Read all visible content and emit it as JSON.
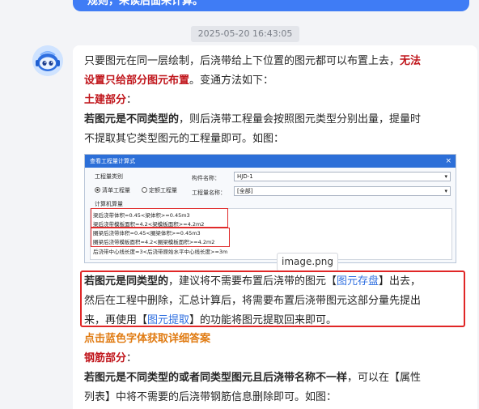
{
  "user_message": {
    "text": "规则，来读后面来计算。"
  },
  "timestamp": "2025-05-20 16:43:05",
  "intro": {
    "line1_normal": "只要图元在同一层绘制，后浇带给上下位置的图元都可以布置上去，",
    "line1_red": "无法",
    "line2_red": "设置只给部分图元布置",
    "line2_normal": "。变通方法如下："
  },
  "civil": {
    "heading": "土建部分",
    "colon": "：",
    "lead_bold": "若图元是不同类型的",
    "lead_rest": "，则后浇带工程量会按照图元类型分别出量，提量时",
    "line2": "不提取其它类型图元的工程量即可。如图："
  },
  "dialog": {
    "title": "查看工程量计算式",
    "close": "×",
    "category_label": "工程量类别",
    "radio_list": "清单工程量",
    "radio_quota": "定额工程量",
    "component_name_label": "构件名称：",
    "component_name_value": "HJD-1",
    "quantity_name_label": "工程量名称：",
    "quantity_name_value": "[全部]",
    "calc_label": "计算机算量",
    "results": [
      "梁后浇带体积=0.45<梁体积>=0.45m3",
      "梁后浇带模板面积=4.2<梁模板面积>=4.2m2",
      "圈梁后浇带体积=0.45<圈梁体积>=0.45m3",
      "圈梁后浇带模板面积=4.2<圈梁模板面积>=4.2m2",
      "后浇带中心线长度=3<后浇带原始水平中心线长度>=3m"
    ]
  },
  "tooltip": "image.png",
  "callout": {
    "lead_bold": "若图元是同类型的",
    "line1_rest": "，建议将不需要布置后浇带的图元【",
    "link1": "图元存盘",
    "line1_end": "】出去，",
    "line2": "然后在工程中删除，汇总计算后，将需要布置后浇带图元这部分量先提出",
    "line3_start": "来，再使用【",
    "link2": "图元提取",
    "line3_end": "】的功能将图元提取回来即可。"
  },
  "blue_prompt": "点击蓝色字体获取详细答案",
  "rebar": {
    "heading": "钢筋部分",
    "colon": "：",
    "lead_bold": "若图元是不同类型的或者同类型图元且后浇带名称不一样",
    "lead_rest": "，可以在【属性",
    "line2": "列表】中将不需要的后浇带钢筋信息删除即可。如图："
  },
  "colors": {
    "accent_blue": "#3f7cf5",
    "red": "#c0151b",
    "orange": "#e07b12",
    "link": "#2f6fe0"
  },
  "icons": {
    "avatar": "robot-avatar-icon",
    "radio": "radio-icon",
    "dropdown": "chevron-down-icon"
  }
}
